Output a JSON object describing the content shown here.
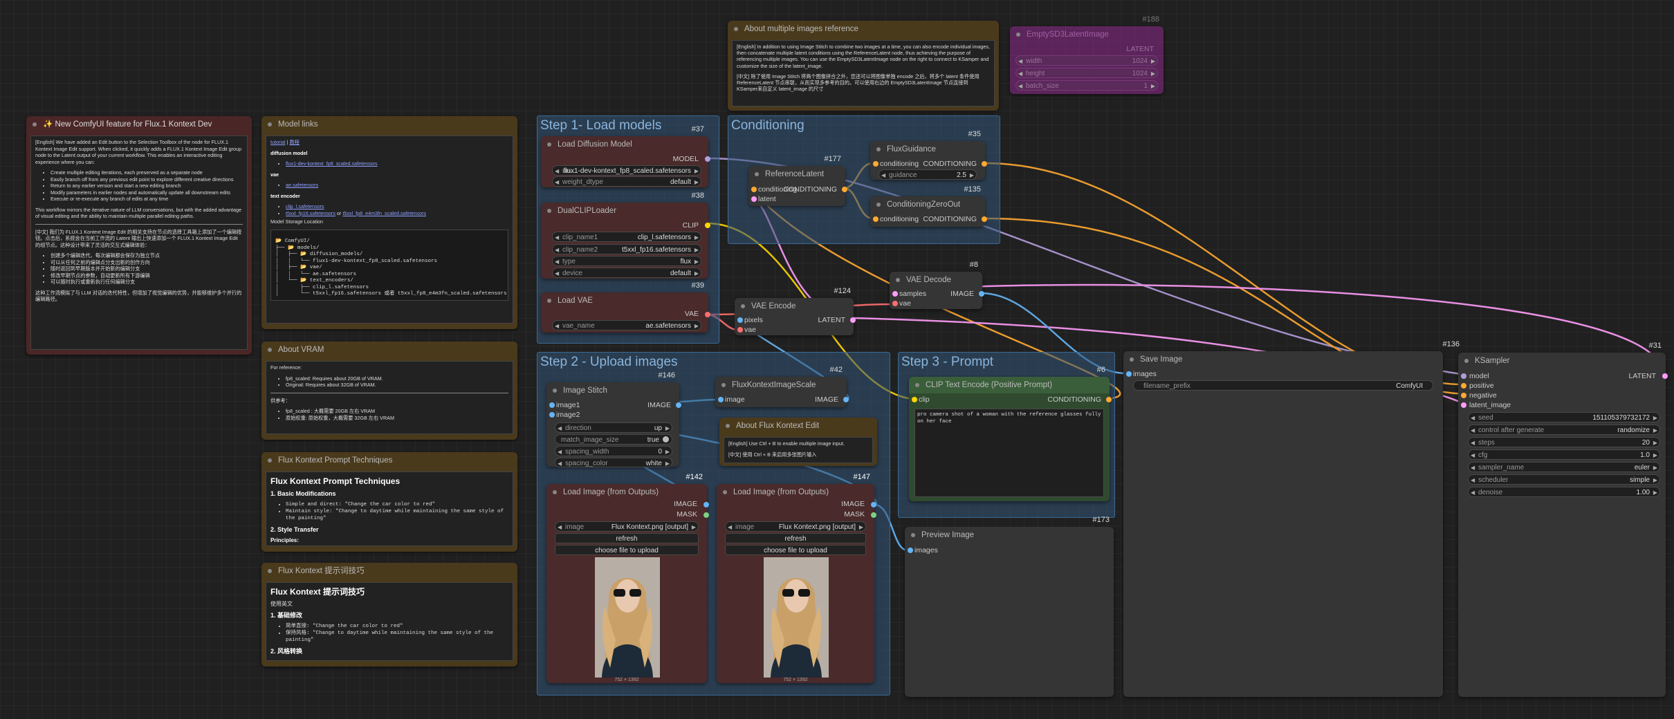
{
  "groups": {
    "step1": "Step 1- Load models",
    "conditioning": "Conditioning",
    "step2": "Step 2 - Upload images",
    "step3": "Step 3 - Prompt"
  },
  "notes": {
    "new_feature": {
      "title": "✨ New ComfyUI feature for Flux.1 Kontext Dev",
      "p1": "[English] We have added an Edit button to the Selection Toolbox of the node for FLUX.1 Kontext Image Edit support. When clicked, it quickly adds a FLUX.1 Kontext Image Edit group node to the Latent output of your current workflow. This enables an interactive editing experience where you can:",
      "bullets": [
        "Create multiple editing iterations, each preserved as a separate node",
        "Easily branch off from any previous edit point to explore different creative directions",
        "Return to any earlier version and start a new editing branch",
        "Modify parameters in earlier nodes and automatically update all downstream edits",
        "Execute or re-execute any branch of edits at any time"
      ],
      "p2": "This workflow mirrors the iterative nature of LLM conversations, but with the added advantage of visual editing and the ability to maintain multiple parallel editing paths.",
      "p3": "[中文] 我们为 FLUX.1 Kontext Image Edit 的相关支持在节点的选择工具箱上添加了一个编辑按钮。点击后，系统会在当前工作流的 Latent 输出上快速添加一个 FLUX.1 Kontext Image Edit 的组节点。这种设计带来了灵活的交互式编辑体验：",
      "bullets_cn": [
        "创建多个编辑迭代，每次编辑都会保存为独立节点",
        "可以从任何之前的编辑点分支出新的创作方向",
        "随时返回到早期版本并开始新的编辑分支",
        "修改早期节点的参数，自动更新所有下游编辑",
        "可以随时执行或重新执行任何编辑分支"
      ],
      "p4": "这种工作流模拟了与 LLM 对话的迭代特性，但增加了视觉编辑的优势，并能够维护多个并行的编辑路径。"
    },
    "model_links": {
      "title": "Model links",
      "top_link_1": "tutorial",
      "top_sep": " | ",
      "top_link_2": "教程",
      "h_diffusion": "diffusion model",
      "l_diffusion": "flux1-dev-kontext_fp8_scaled.safetensors",
      "h_vae": "vae",
      "l_vae": "ae.safetensors",
      "h_te": "text encoder",
      "l_te1": "clip_l.safetensors",
      "l_te2": "t5xxl_fp16.safetensors",
      "te_or": " or ",
      "l_te3": "t5xxl_fp8_e4m3fn_scaled.safetensors",
      "h_storage": "Model Storage Location",
      "tree": [
        "📂 ComfyUI/",
        "├── 📂 models/",
        "│   ├── 📂 diffusion_models/",
        "│   │   └── flux1-dev-kontext_fp8_scaled.safetensors",
        "│   ├── 📂 vae/",
        "│   │   └── ae.safetensors",
        "│   └── 📂 text_encoders/",
        "│       ├── clip_l.safetensors",
        "│       └── t5xxl_fp16.safetensors 或者 t5xxl_fp8_e4m3fn_scaled.safetensors"
      ]
    },
    "vram": {
      "title": "About VRAM",
      "p1": "For reference:",
      "b1": [
        "fp8_scaled: Requires about 20GB of VRAM.",
        "Original: Requires about 32GB of VRAM."
      ],
      "p2": "供参考：",
      "b2": [
        "fp8_scaled : 大概需要 20GB 左右 VRAM",
        "原始权重: 原始权重，大概需要 32GB 左右 VRAM"
      ]
    },
    "techniques_en": {
      "title": "Flux Kontext Prompt Techniques",
      "h": "Flux Kontext Prompt Techniques",
      "h1": "1. Basic Modifications",
      "b": [
        "Simple and direct: \"Change the car color to red\"",
        "Maintain style: \"Change to daytime while maintaining the same style of the painting\""
      ],
      "h2": "2. Style Transfer",
      "h3": "Principles:"
    },
    "techniques_cn": {
      "title": "Flux Kontext 提示词技巧",
      "h": "Flux Kontext 提示词技巧",
      "p": "使用英文",
      "h1": "1. 基础修改",
      "b": [
        "简单直接: \"Change the car color to red\"",
        "保持风格: \"Change to daytime while maintaining the same style of the painting\""
      ],
      "h2": "2. 风格转换"
    },
    "multi_ref": {
      "title": "About multiple images reference",
      "p1": "[English] In addition to using Image Stitch to combine two images at a time, you can also encode individual images, then concatenate multiple latent conditions using the ReferenceLatent node, thus achieving the purpose of referencing multiple images. You can use the EmptySD3LatentImage node on the right to connect to KSamper and customize the size of the latent_image.",
      "p2": "[中文] 除了使用 Image Stitch 将两个图像拼合之外，您还可以将图像单独 encode 之后，将多个 latent 条件使用 ReferenceLatent 节点串联，从而实现多参考的目的。可以使用右边的 EmptySD3LatentImage 节点连接到 KSamper来自定义 latent_image 的尺寸"
    },
    "about_edit": {
      "title": "About Flux Kontext Edit",
      "p1": "[English] Use Ctrl + B to enable multiple image input.",
      "p2": "[中文] 使用 Ctrl + B 来启用多张图片输入"
    }
  },
  "nodes": {
    "load_diffusion": {
      "title": "Load Diffusion Model",
      "id": "#37",
      "out": "MODEL",
      "w1_label": "un...",
      "w1_value": "flux1-dev-kontext_fp8_scaled.safetensors",
      "w2_label": "weight_dtype",
      "w2_value": "default"
    },
    "dualclip": {
      "title": "DualCLIPLoader",
      "id": "#38",
      "out": "CLIP",
      "w1_label": "clip_name1",
      "w1_value": "clip_l.safetensors",
      "w2_label": "clip_name2",
      "w2_value": "t5xxl_fp16.safetensors",
      "w3_label": "type",
      "w3_value": "flux",
      "w4_label": "device",
      "w4_value": "default"
    },
    "load_vae": {
      "title": "Load VAE",
      "id": "#39",
      "out": "VAE",
      "w1_label": "vae_name",
      "w1_value": "ae.safetensors"
    },
    "reference_latent": {
      "title": "ReferenceLatent",
      "id": "#177",
      "in1": "conditioning",
      "in2": "latent",
      "out": "CONDITIONING"
    },
    "flux_guidance": {
      "title": "FluxGuidance",
      "id": "#35",
      "in1": "conditioning",
      "out": "CONDITIONING",
      "w1_label": "guidance",
      "w1_value": "2.5"
    },
    "cond_zero": {
      "title": "ConditioningZeroOut",
      "id": "#135",
      "in1": "conditioning",
      "out": "CONDITIONING"
    },
    "vae_decode": {
      "title": "VAE Decode",
      "id": "#8",
      "in1": "samples",
      "in2": "vae",
      "out": "IMAGE"
    },
    "vae_encode": {
      "title": "VAE Encode",
      "id": "#124",
      "in1": "pixels",
      "in2": "vae",
      "out": "LATENT"
    },
    "empty_sd3": {
      "title": "EmptySD3LatentImage",
      "id": "#188",
      "out": "LATENT",
      "w1_label": "width",
      "w1_value": "1024",
      "w2_label": "height",
      "w2_value": "1024",
      "w3_label": "batch_size",
      "w3_value": "1"
    },
    "image_stitch": {
      "title": "Image Stitch",
      "id": "#146",
      "in1": "image1",
      "in2": "image2",
      "out": "IMAGE",
      "w1_label": "direction",
      "w1_value": "up",
      "w2_label": "match_image_size",
      "w2_value": "true",
      "w3_label": "spacing_width",
      "w3_value": "0",
      "w4_label": "spacing_color",
      "w4_value": "white"
    },
    "flux_scale": {
      "title": "FluxKontextImageScale",
      "id": "#42",
      "in1": "image",
      "out": "IMAGE"
    },
    "load_image_1": {
      "title": "Load Image (from Outputs)",
      "id": "#142",
      "out1": "IMAGE",
      "out2": "MASK",
      "w1_label": "image",
      "w1_value": "Flux Kontext.png [output]",
      "btn1": "refresh",
      "btn2": "choose file to upload",
      "size": "752 × 1392"
    },
    "load_image_2": {
      "title": "Load Image (from Outputs)",
      "id": "#147",
      "out1": "IMAGE",
      "out2": "MASK",
      "w1_label": "image",
      "w1_value": "Flux Kontext.png [output]",
      "btn1": "refresh",
      "btn2": "choose file to upload",
      "size": "752 × 1392"
    },
    "clip_text": {
      "title": "CLIP Text Encode (Positive Prompt)",
      "id": "#6",
      "in1": "clip",
      "out": "CONDITIONING",
      "text": "pro camera shot of a woman with the reference glasses fully on her face"
    },
    "preview": {
      "title": "Preview Image",
      "id": "#173",
      "in1": "images"
    },
    "save_image": {
      "title": "Save Image",
      "id": "#136",
      "in1": "images",
      "w1_label": "filename_prefix",
      "w1_value": "ComfyUI"
    },
    "ksampler": {
      "title": "KSampler",
      "id": "#31",
      "in1": "model",
      "in2": "positive",
      "in3": "negative",
      "in4": "latent_image",
      "out": "LATENT",
      "widgets": [
        {
          "label": "seed",
          "value": "151105379732172"
        },
        {
          "label": "control after generate",
          "value": "randomize"
        },
        {
          "label": "steps",
          "value": "20"
        },
        {
          "label": "cfg",
          "value": "1.0"
        },
        {
          "label": "sampler_name",
          "value": "euler"
        },
        {
          "label": "scheduler",
          "value": "simple"
        },
        {
          "label": "denoise",
          "value": "1.00"
        }
      ]
    }
  },
  "colors": {
    "model": "#b39ddb",
    "clip": "#ffd500",
    "vae": "#ff6e6e",
    "conditioning": "#ffa931",
    "latent": "#ff9cf9",
    "image": "#64b5f6"
  }
}
